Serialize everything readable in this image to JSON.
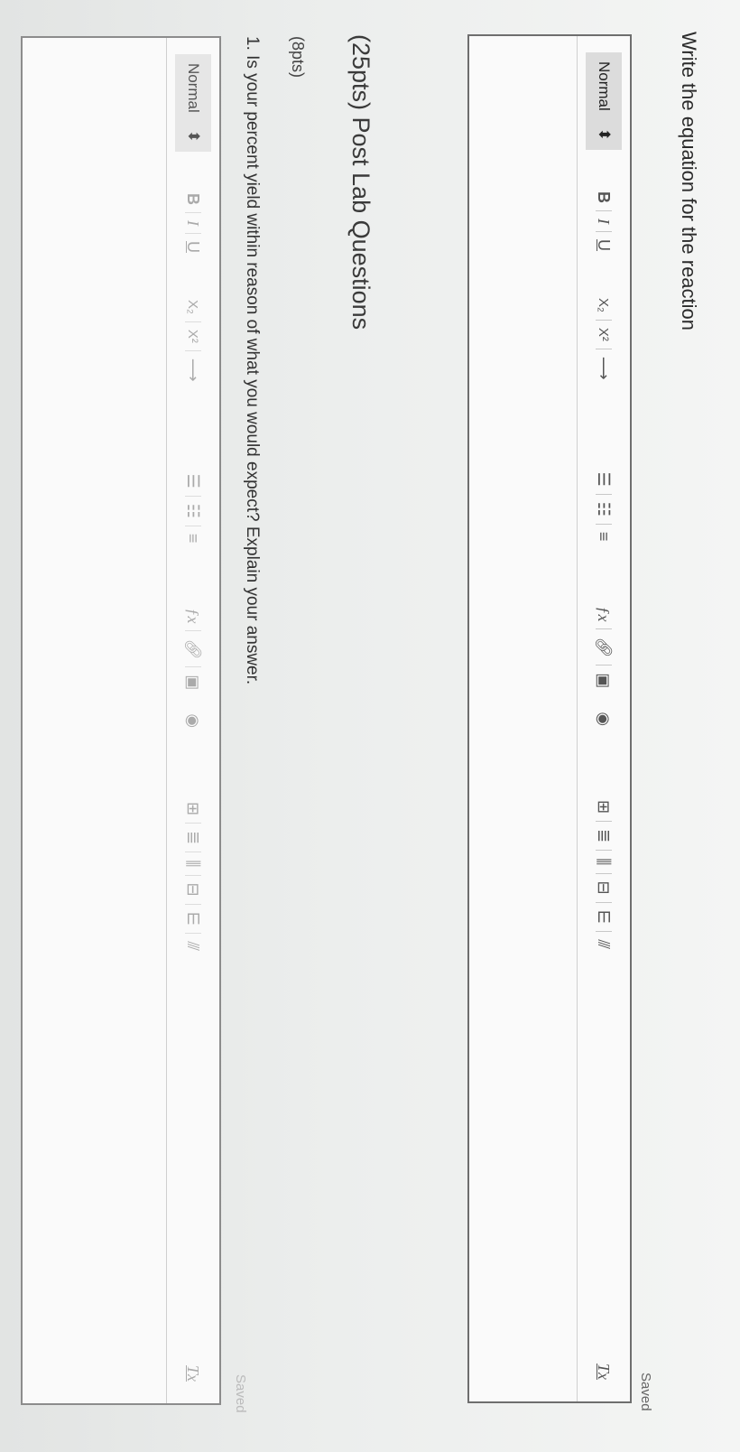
{
  "prompt": "Write the equation for the reaction",
  "editors": [
    {
      "saved_label": "Saved",
      "format_value": "Normal",
      "toolbar": {
        "bold": "B",
        "italic": "I",
        "underline": "U",
        "subscript": "X₂",
        "superscript": "X²",
        "clear_format": "Tx"
      }
    },
    {
      "saved_label": "Saved",
      "format_value": "Normal",
      "toolbar": {
        "bold": "B",
        "italic": "I",
        "underline": "U",
        "subscript": "X₂",
        "superscript": "X²",
        "clear_format": "Tx"
      }
    }
  ],
  "section_heading": "(25pts) Post Lab Questions",
  "points": "(8pts)",
  "question": "1. Is your percent yield within reason of what you would expect? Explain your answer."
}
